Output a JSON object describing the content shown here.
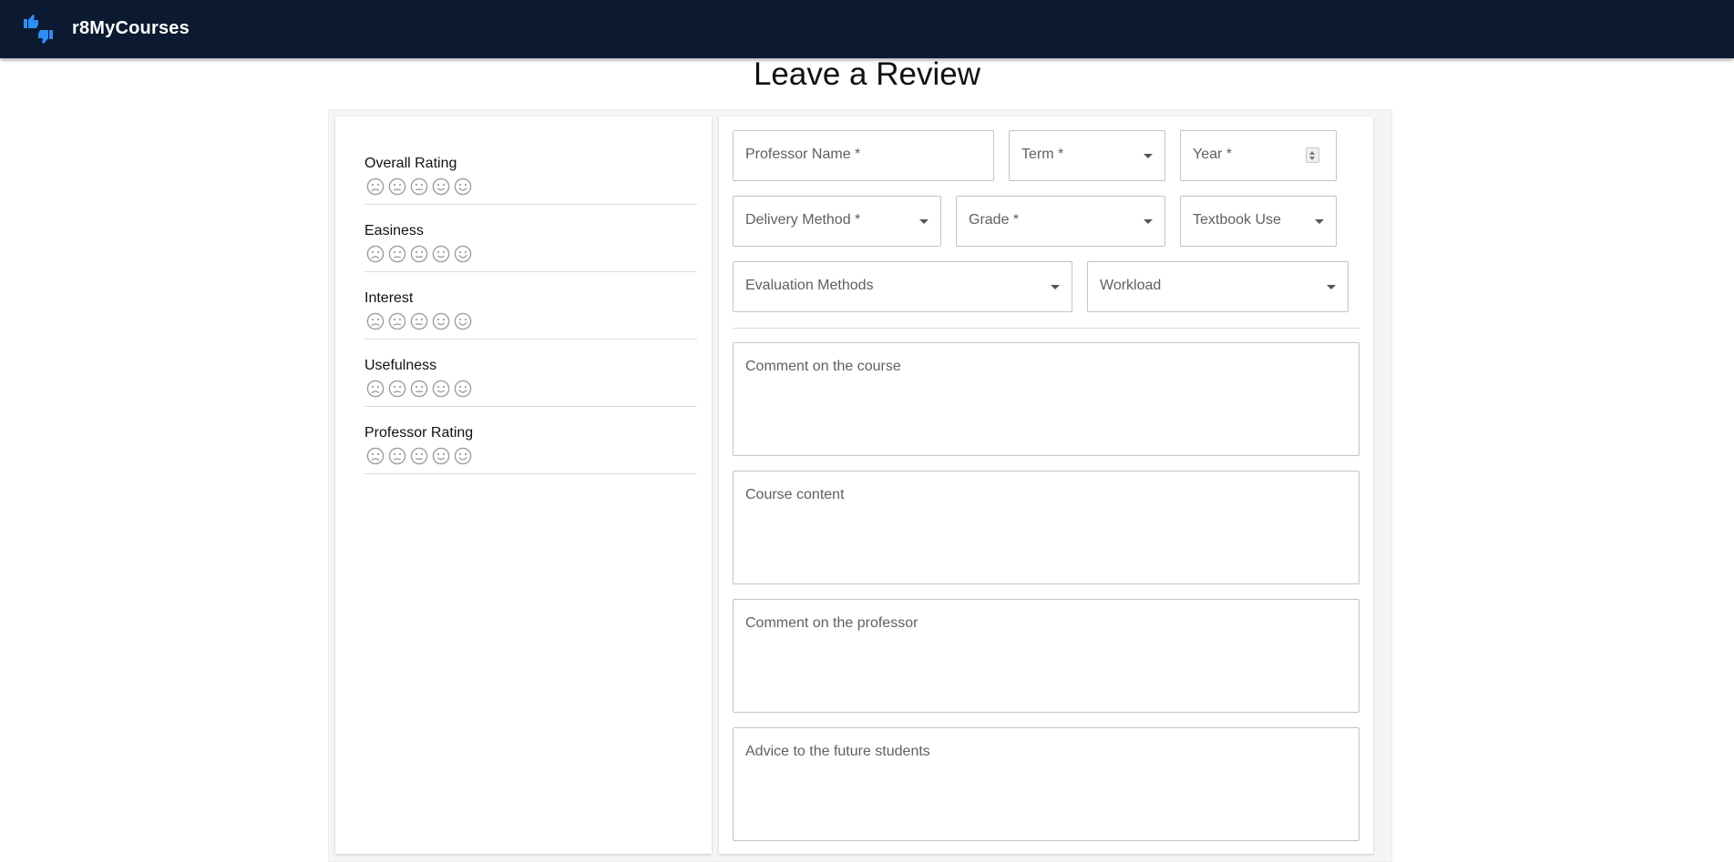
{
  "appbar": {
    "brand": "r8MyCourses",
    "logo_icon": "thumbs-up-down-icon",
    "background": "#0b1a30",
    "logo_color": "#2f8ef2"
  },
  "page": {
    "title": "Leave a Review"
  },
  "ratings": [
    {
      "label": "Overall Rating"
    },
    {
      "label": "Easiness"
    },
    {
      "label": "Interest"
    },
    {
      "label": "Usefulness"
    },
    {
      "label": "Professor Rating"
    }
  ],
  "rating_icons": [
    "very-dissatisfied-icon",
    "dissatisfied-icon",
    "neutral-icon",
    "satisfied-icon",
    "very-satisfied-icon"
  ],
  "fields": {
    "professor_name": "Professor Name *",
    "term": "Term *",
    "year": "Year *",
    "delivery_method": "Delivery Method *",
    "grade": "Grade *",
    "textbook_use": "Textbook Use",
    "evaluation_methods": "Evaluation Methods",
    "workload": "Workload"
  },
  "textareas": {
    "course_comment": "Comment on the course",
    "course_content": "Course content",
    "professor_comment": "Comment on the professor",
    "advice": "Advice to the future students"
  }
}
